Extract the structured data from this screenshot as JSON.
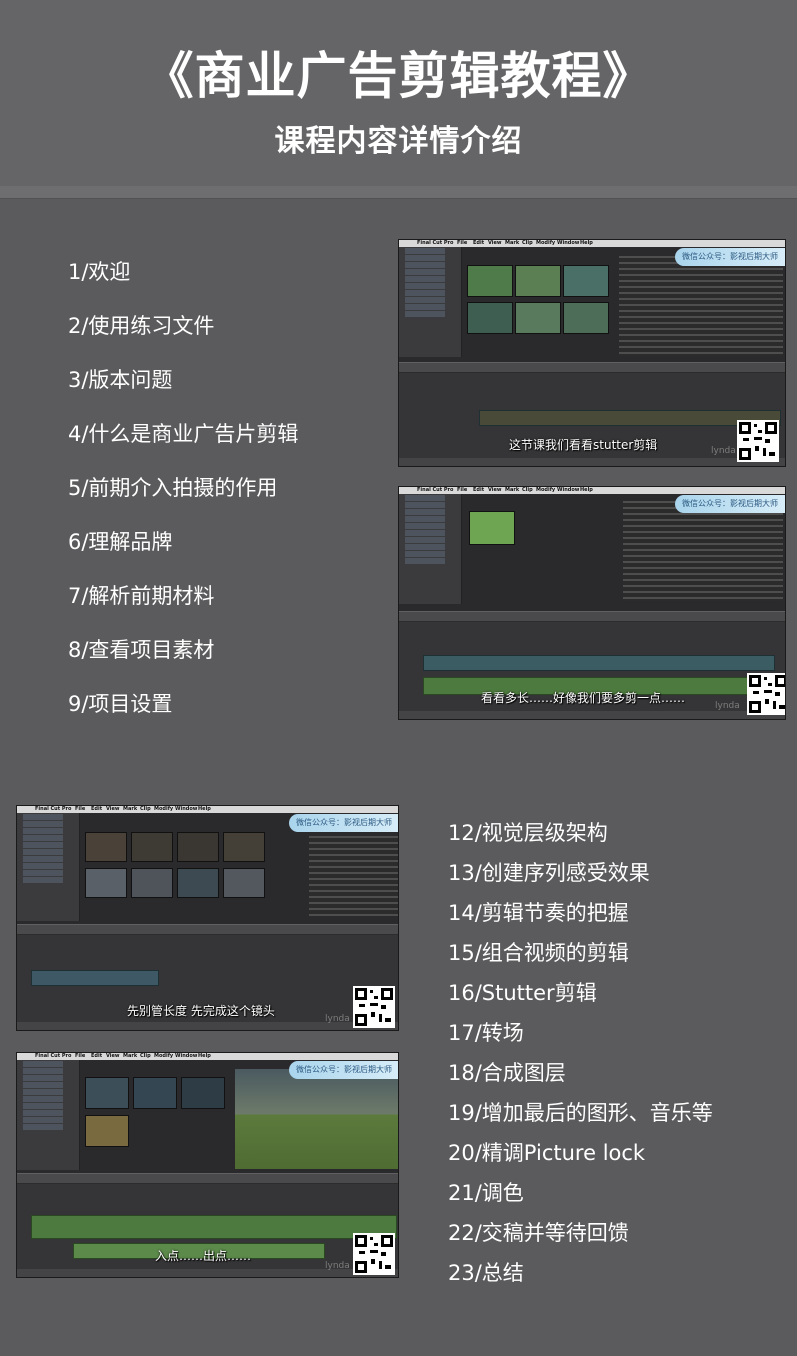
{
  "header": {
    "title": "《商业广告剪辑教程》",
    "subtitle": "课程内容详情介绍"
  },
  "lessons_part1": [
    "1/欢迎",
    "2/使用练习文件",
    "3/版本问题",
    "4/什么是商业广告片剪辑",
    "5/前期介入拍摄的作用",
    "6/理解品牌",
    "7/解析前期材料",
    "8/查看项目素材",
    "9/项目设置"
  ],
  "lessons_part2": [
    "12/视觉层级架构",
    "13/创建序列感受效果",
    "14/剪辑节奏的把握",
    "15/组合视频的剪辑",
    "16/Stutter剪辑",
    "17/转场",
    "18/合成图层",
    "19/增加最后的图形、音乐等",
    "20/精调Picture lock",
    "21/调色",
    "22/交稿并等待回馈",
    "23/总结"
  ],
  "screenshots": {
    "app_name": "Final Cut Pro",
    "menu": [
      "File",
      "Edit",
      "View",
      "Mark",
      "Clip",
      "Modify",
      "Window",
      "Help"
    ],
    "watermark": "微信公众号：影视后期大师",
    "brand": "lynda",
    "captions": [
      "这节课我们看看stutter剪辑",
      "看看多长……好像我们要多剪一点……",
      "先别管长度 先完成这个镜头",
      "入点……出点……"
    ]
  }
}
